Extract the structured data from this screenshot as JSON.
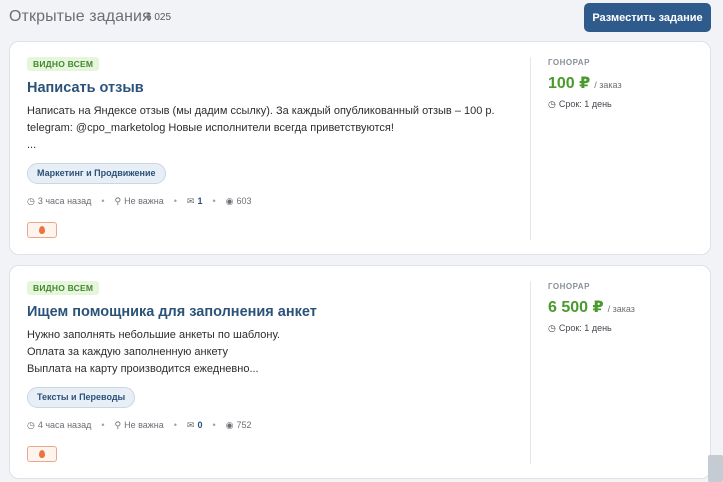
{
  "header": {
    "title": "Открытые задания",
    "count": "6 025",
    "post_button": "Разместить задание"
  },
  "labels": {
    "fee": "ГОНОРАР",
    "per_order": "/ заказ"
  },
  "tasks": [
    {
      "visibility": "ВИДНО ВСЕМ",
      "title": "Написать отзыв",
      "description": [
        "Написать на Яндексе отзыв (мы дадим ссылку). За каждый опубликованный отзыв – 100 р.",
        "telegram: @cpo_marketolog Новые исполнители всегда приветствуются!",
        "..."
      ],
      "category": "Маркетинг и Продвижение",
      "posted": "3 часа назад",
      "location": "Не важна",
      "responses": "1",
      "views": "603",
      "price": "100 ₽",
      "term": "Срок: 1 день"
    },
    {
      "visibility": "ВИДНО ВСЕМ",
      "title": "Ищем помощника для заполнения анкет",
      "description": [
        "Нужно заполнять небольшие анкеты по шаблону.",
        "Оплата за каждую заполненную анкету",
        "Выплата на карту производится ежедневно..."
      ],
      "category": "Тексты и Переводы",
      "posted": "4 часа назад",
      "location": "Не важна",
      "responses": "0",
      "views": "752",
      "price": "6 500 ₽",
      "term": "Срок: 1 день"
    }
  ],
  "icons": {
    "clock": "clock-icon",
    "location": "map-pin-icon",
    "comments": "comments-icon",
    "views": "eye-icon",
    "hot": "fire-icon"
  },
  "colors": {
    "accent": "#2f5b8c",
    "price": "#4a9a2e",
    "badge_bg": "#e6f5dc",
    "badge_text": "#3f8a2e",
    "title": "#2b5278"
  }
}
